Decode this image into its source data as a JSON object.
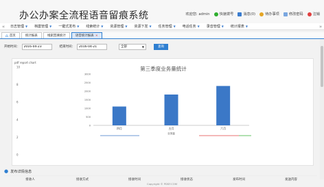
{
  "app": {
    "title": "办公办案全流程语音留痕系统"
  },
  "top_links": [
    {
      "label": "欢迎您: admin",
      "color": "#ffffff"
    },
    {
      "label": "快速拨号",
      "color": "#2fae2f"
    },
    {
      "label": "消息(0)",
      "color": "#3a7ccf"
    },
    {
      "label": "待办事项",
      "color": "#e5a524"
    },
    {
      "label": "修改密码",
      "color": "#7aa7e0"
    },
    {
      "label": "注销",
      "color": "#e04040"
    }
  ],
  "nav": {
    "items": [
      {
        "label": "日志管理"
      },
      {
        "label": "档案管理"
      },
      {
        "label": "一键式发布"
      },
      {
        "label": "线索统计"
      },
      {
        "label": "资源管理"
      },
      {
        "label": "资源下发"
      },
      {
        "label": "任务管理"
      },
      {
        "label": "电话任务"
      },
      {
        "label": "录音管理"
      },
      {
        "label": "统计报表"
      }
    ]
  },
  "tabs": [
    {
      "label": "首页"
    },
    {
      "label": "统计报表"
    },
    {
      "label": "线索回填统计"
    },
    {
      "label": "语音统计报表"
    }
  ],
  "filter": {
    "start_label": "开始时间：",
    "start_value": "2016-04-23",
    "end_label": "结束时间：",
    "end_value": "2016-04-21",
    "select_value": "全部",
    "query_button": "查询"
  },
  "chart_data": {
    "type": "bar",
    "title": "第三季度业务量统计",
    "small_title": "pdf report chart",
    "categories": [
      "四月",
      "五月",
      "六月"
    ],
    "values": [
      1100,
      1800,
      2300
    ],
    "xlabel": "",
    "ylabel": "",
    "ylim": [
      0,
      3000
    ],
    "yticks": [
      0,
      500,
      1000,
      1500,
      2000,
      2500,
      3000
    ],
    "outer_ylim": [
      0,
      10
    ],
    "outer_yticks": [
      0,
      2,
      4,
      6,
      8,
      10
    ],
    "bar_color": "#3b78c7",
    "legend_label": "业务量",
    "grid": false
  },
  "section": {
    "title": "发布详情信息"
  },
  "table": {
    "columns": [
      "接收人",
      "接收方式",
      "接收时间",
      "接收状态",
      "发布时间",
      "发送内容"
    ]
  },
  "footer": {
    "text": "Copyright © PDSF.COM"
  }
}
